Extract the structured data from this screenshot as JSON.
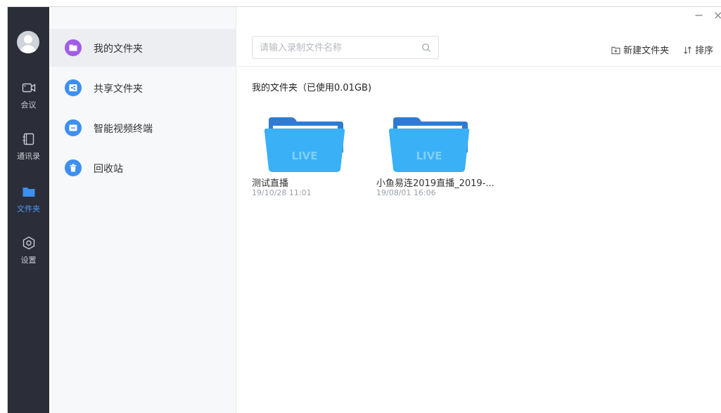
{
  "rail": {
    "items": [
      {
        "label": "会议",
        "icon": "video-camera-icon"
      },
      {
        "label": "通讯录",
        "icon": "contacts-icon"
      },
      {
        "label": "文件夹",
        "icon": "folder-icon"
      },
      {
        "label": "设置",
        "icon": "gear-icon"
      }
    ],
    "active_index": 2,
    "active_color": "#4a9bff"
  },
  "subnav": {
    "items": [
      {
        "label": "我的文件夹",
        "icon": "folder-icon",
        "color": "#a15de6"
      },
      {
        "label": "共享文件夹",
        "icon": "share-icon",
        "color": "#3d8ff0"
      },
      {
        "label": "智能视频终端",
        "icon": "terminal-icon",
        "color": "#3d8ff0"
      },
      {
        "label": "回收站",
        "icon": "trash-icon",
        "color": "#3d8ff0"
      }
    ],
    "active_index": 0
  },
  "window_controls": {
    "minimize": "−",
    "close": "×"
  },
  "search": {
    "placeholder": "请输入录制文件名称",
    "value": ""
  },
  "toolbar": {
    "new_folder_label": "新建文件夹",
    "sort_label": "排序"
  },
  "folder_title": "我的文件夹（已使用0.01GB)",
  "files": [
    {
      "name": "测试直播",
      "date": "19/10/28 11:01",
      "tag": "LIVE"
    },
    {
      "name": "小鱼易连2019直播_2019-...",
      "date": "19/08/01 16:06",
      "tag": "LIVE"
    }
  ],
  "colors": {
    "rail_bg": "#2b2e38",
    "folder_blue": "#3ab0f6",
    "folder_back": "#2f7bd1"
  }
}
